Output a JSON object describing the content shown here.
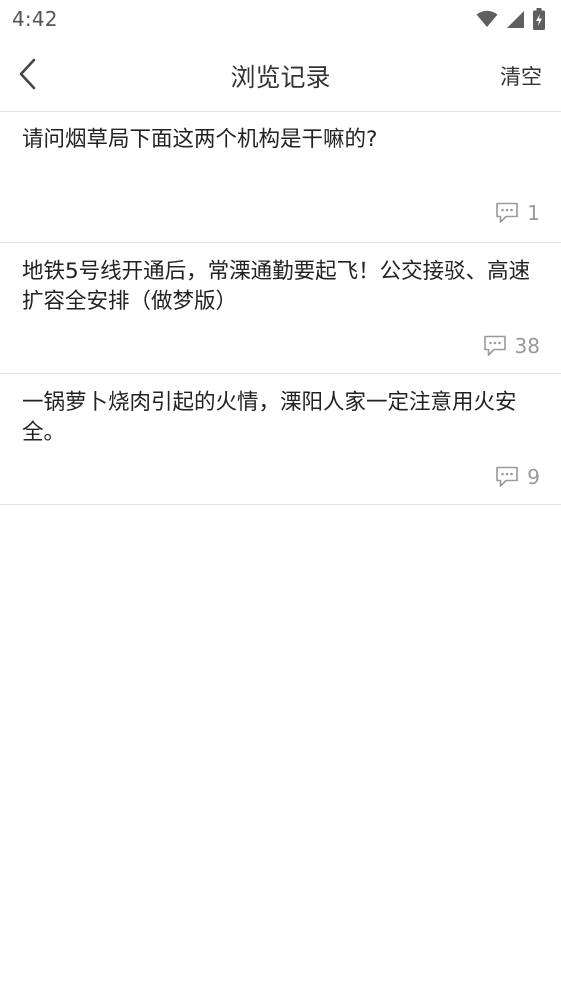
{
  "status_bar": {
    "time": "4:42",
    "icons": [
      "wifi-icon",
      "cellular-signal-icon",
      "battery-charging-icon"
    ]
  },
  "header": {
    "back_icon": "chevron-left-icon",
    "title": "浏览记录",
    "clear_label": "清空"
  },
  "history": [
    {
      "title": "请问烟草局下面这两个机构是干嘛的?",
      "comments": "1"
    },
    {
      "title": "地铁5号线开通后，常溧通勤要起飞！公交接驳、高速扩容全安排（做梦版）",
      "comments": "38"
    },
    {
      "title": "一锅萝卜烧肉引起的火情，溧阳人家一定注意用火安全。",
      "comments": "9"
    }
  ],
  "colors": {
    "text_primary": "#222222",
    "text_secondary": "#999999",
    "divider": "#e6e6e6",
    "background": "#ffffff"
  }
}
